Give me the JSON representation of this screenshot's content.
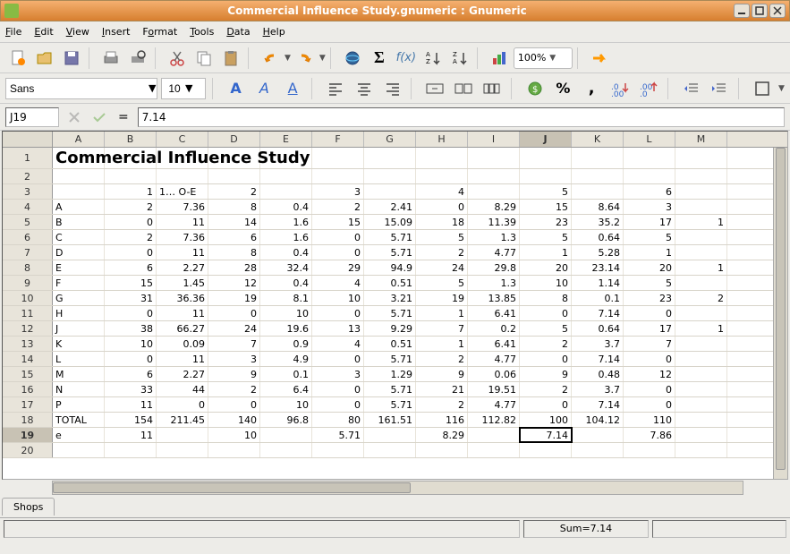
{
  "window": {
    "title": "Commercial Influence Study.gnumeric : Gnumeric"
  },
  "menu": [
    "File",
    "Edit",
    "View",
    "Insert",
    "Format",
    "Tools",
    "Data",
    "Help"
  ],
  "toolbar": {
    "zoom": "100%"
  },
  "format": {
    "font": "Sans",
    "size": "10"
  },
  "cellref": "J19",
  "formula": "7.14",
  "status_sum": "Sum=7.14",
  "sheet_tab": "Shops",
  "columns": [
    "A",
    "B",
    "C",
    "D",
    "E",
    "F",
    "G",
    "H",
    "I",
    "J",
    "K",
    "L",
    "M"
  ],
  "active_col_idx": 9,
  "active_row_idx": 18,
  "title_cell": "Commercial Influence Study",
  "rows": [
    {
      "n": 1,
      "cells": [
        {
          "v": "Commercial Influence Study",
          "big": true
        }
      ]
    },
    {
      "n": 2,
      "cells": []
    },
    {
      "n": 3,
      "cells": [
        null,
        {
          "v": "1",
          "r": 1
        },
        {
          "v": "1… O-E",
          "t": 1
        },
        {
          "v": "2",
          "r": 1
        },
        null,
        {
          "v": "3",
          "r": 1
        },
        null,
        {
          "v": "4",
          "r": 1
        },
        null,
        {
          "v": "5",
          "r": 1
        },
        null,
        {
          "v": "6",
          "r": 1
        }
      ]
    },
    {
      "n": 4,
      "cells": [
        {
          "v": "A",
          "t": 1
        },
        {
          "v": "2"
        },
        {
          "v": "7.36"
        },
        {
          "v": "8"
        },
        {
          "v": "0.4"
        },
        {
          "v": "2"
        },
        {
          "v": "2.41"
        },
        {
          "v": "0"
        },
        {
          "v": "8.29"
        },
        {
          "v": "15"
        },
        {
          "v": "8.64"
        },
        {
          "v": "3"
        }
      ]
    },
    {
      "n": 5,
      "cells": [
        {
          "v": "B",
          "t": 1
        },
        {
          "v": "0"
        },
        {
          "v": "11"
        },
        {
          "v": "14"
        },
        {
          "v": "1.6"
        },
        {
          "v": "15"
        },
        {
          "v": "15.09"
        },
        {
          "v": "18"
        },
        {
          "v": "11.39"
        },
        {
          "v": "23"
        },
        {
          "v": "35.2"
        },
        {
          "v": "17"
        },
        {
          "v": "1"
        }
      ]
    },
    {
      "n": 6,
      "cells": [
        {
          "v": "C",
          "t": 1
        },
        {
          "v": "2"
        },
        {
          "v": "7.36"
        },
        {
          "v": "6"
        },
        {
          "v": "1.6"
        },
        {
          "v": "0"
        },
        {
          "v": "5.71"
        },
        {
          "v": "5"
        },
        {
          "v": "1.3"
        },
        {
          "v": "5"
        },
        {
          "v": "0.64"
        },
        {
          "v": "5"
        }
      ]
    },
    {
      "n": 7,
      "cells": [
        {
          "v": "D",
          "t": 1
        },
        {
          "v": "0"
        },
        {
          "v": "11"
        },
        {
          "v": "8"
        },
        {
          "v": "0.4"
        },
        {
          "v": "0"
        },
        {
          "v": "5.71"
        },
        {
          "v": "2"
        },
        {
          "v": "4.77"
        },
        {
          "v": "1"
        },
        {
          "v": "5.28"
        },
        {
          "v": "1"
        }
      ]
    },
    {
      "n": 8,
      "cells": [
        {
          "v": "E",
          "t": 1
        },
        {
          "v": "6"
        },
        {
          "v": "2.27"
        },
        {
          "v": "28"
        },
        {
          "v": "32.4"
        },
        {
          "v": "29"
        },
        {
          "v": "94.9"
        },
        {
          "v": "24"
        },
        {
          "v": "29.8"
        },
        {
          "v": "20"
        },
        {
          "v": "23.14"
        },
        {
          "v": "20"
        },
        {
          "v": "1"
        }
      ]
    },
    {
      "n": 9,
      "cells": [
        {
          "v": "F",
          "t": 1
        },
        {
          "v": "15"
        },
        {
          "v": "1.45"
        },
        {
          "v": "12"
        },
        {
          "v": "0.4"
        },
        {
          "v": "4"
        },
        {
          "v": "0.51"
        },
        {
          "v": "5"
        },
        {
          "v": "1.3"
        },
        {
          "v": "10"
        },
        {
          "v": "1.14"
        },
        {
          "v": "5"
        }
      ]
    },
    {
      "n": 10,
      "cells": [
        {
          "v": "G",
          "t": 1
        },
        {
          "v": "31"
        },
        {
          "v": "36.36"
        },
        {
          "v": "19"
        },
        {
          "v": "8.1"
        },
        {
          "v": "10"
        },
        {
          "v": "3.21"
        },
        {
          "v": "19"
        },
        {
          "v": "13.85"
        },
        {
          "v": "8"
        },
        {
          "v": "0.1"
        },
        {
          "v": "23"
        },
        {
          "v": "2"
        }
      ]
    },
    {
      "n": 11,
      "cells": [
        {
          "v": "H",
          "t": 1
        },
        {
          "v": "0"
        },
        {
          "v": "11"
        },
        {
          "v": "0"
        },
        {
          "v": "10"
        },
        {
          "v": "0"
        },
        {
          "v": "5.71"
        },
        {
          "v": "1"
        },
        {
          "v": "6.41"
        },
        {
          "v": "0"
        },
        {
          "v": "7.14"
        },
        {
          "v": "0"
        }
      ]
    },
    {
      "n": 12,
      "cells": [
        {
          "v": "J",
          "t": 1
        },
        {
          "v": "38"
        },
        {
          "v": "66.27"
        },
        {
          "v": "24"
        },
        {
          "v": "19.6"
        },
        {
          "v": "13"
        },
        {
          "v": "9.29"
        },
        {
          "v": "7"
        },
        {
          "v": "0.2"
        },
        {
          "v": "5"
        },
        {
          "v": "0.64"
        },
        {
          "v": "17"
        },
        {
          "v": "1"
        }
      ]
    },
    {
      "n": 13,
      "cells": [
        {
          "v": "K",
          "t": 1
        },
        {
          "v": "10"
        },
        {
          "v": "0.09"
        },
        {
          "v": "7"
        },
        {
          "v": "0.9"
        },
        {
          "v": "4"
        },
        {
          "v": "0.51"
        },
        {
          "v": "1"
        },
        {
          "v": "6.41"
        },
        {
          "v": "2"
        },
        {
          "v": "3.7"
        },
        {
          "v": "7"
        }
      ]
    },
    {
      "n": 14,
      "cells": [
        {
          "v": "L",
          "t": 1
        },
        {
          "v": "0"
        },
        {
          "v": "11"
        },
        {
          "v": "3"
        },
        {
          "v": "4.9"
        },
        {
          "v": "0"
        },
        {
          "v": "5.71"
        },
        {
          "v": "2"
        },
        {
          "v": "4.77"
        },
        {
          "v": "0"
        },
        {
          "v": "7.14"
        },
        {
          "v": "0"
        }
      ]
    },
    {
      "n": 15,
      "cells": [
        {
          "v": "M",
          "t": 1
        },
        {
          "v": "6"
        },
        {
          "v": "2.27"
        },
        {
          "v": "9"
        },
        {
          "v": "0.1"
        },
        {
          "v": "3"
        },
        {
          "v": "1.29"
        },
        {
          "v": "9"
        },
        {
          "v": "0.06"
        },
        {
          "v": "9"
        },
        {
          "v": "0.48"
        },
        {
          "v": "12"
        }
      ]
    },
    {
      "n": 16,
      "cells": [
        {
          "v": "N",
          "t": 1
        },
        {
          "v": "33"
        },
        {
          "v": "44"
        },
        {
          "v": "2"
        },
        {
          "v": "6.4"
        },
        {
          "v": "0"
        },
        {
          "v": "5.71"
        },
        {
          "v": "21"
        },
        {
          "v": "19.51"
        },
        {
          "v": "2"
        },
        {
          "v": "3.7"
        },
        {
          "v": "0"
        }
      ]
    },
    {
      "n": 17,
      "cells": [
        {
          "v": "P",
          "t": 1
        },
        {
          "v": "11"
        },
        {
          "v": "0"
        },
        {
          "v": "0"
        },
        {
          "v": "10"
        },
        {
          "v": "0"
        },
        {
          "v": "5.71"
        },
        {
          "v": "2"
        },
        {
          "v": "4.77"
        },
        {
          "v": "0"
        },
        {
          "v": "7.14"
        },
        {
          "v": "0"
        }
      ]
    },
    {
      "n": 18,
      "cells": [
        {
          "v": "TOTAL",
          "t": 1
        },
        {
          "v": "154"
        },
        {
          "v": "211.45"
        },
        {
          "v": "140"
        },
        {
          "v": "96.8"
        },
        {
          "v": "80"
        },
        {
          "v": "161.51"
        },
        {
          "v": "116"
        },
        {
          "v": "112.82"
        },
        {
          "v": "100"
        },
        {
          "v": "104.12"
        },
        {
          "v": "110"
        }
      ]
    },
    {
      "n": 19,
      "cells": [
        {
          "v": "e",
          "t": 1
        },
        {
          "v": "11"
        },
        null,
        {
          "v": "10"
        },
        null,
        {
          "v": "5.71"
        },
        null,
        {
          "v": "8.29"
        },
        null,
        {
          "v": "7.14",
          "sel": 1
        },
        null,
        {
          "v": "7.86"
        }
      ]
    },
    {
      "n": 20,
      "cells": []
    }
  ]
}
